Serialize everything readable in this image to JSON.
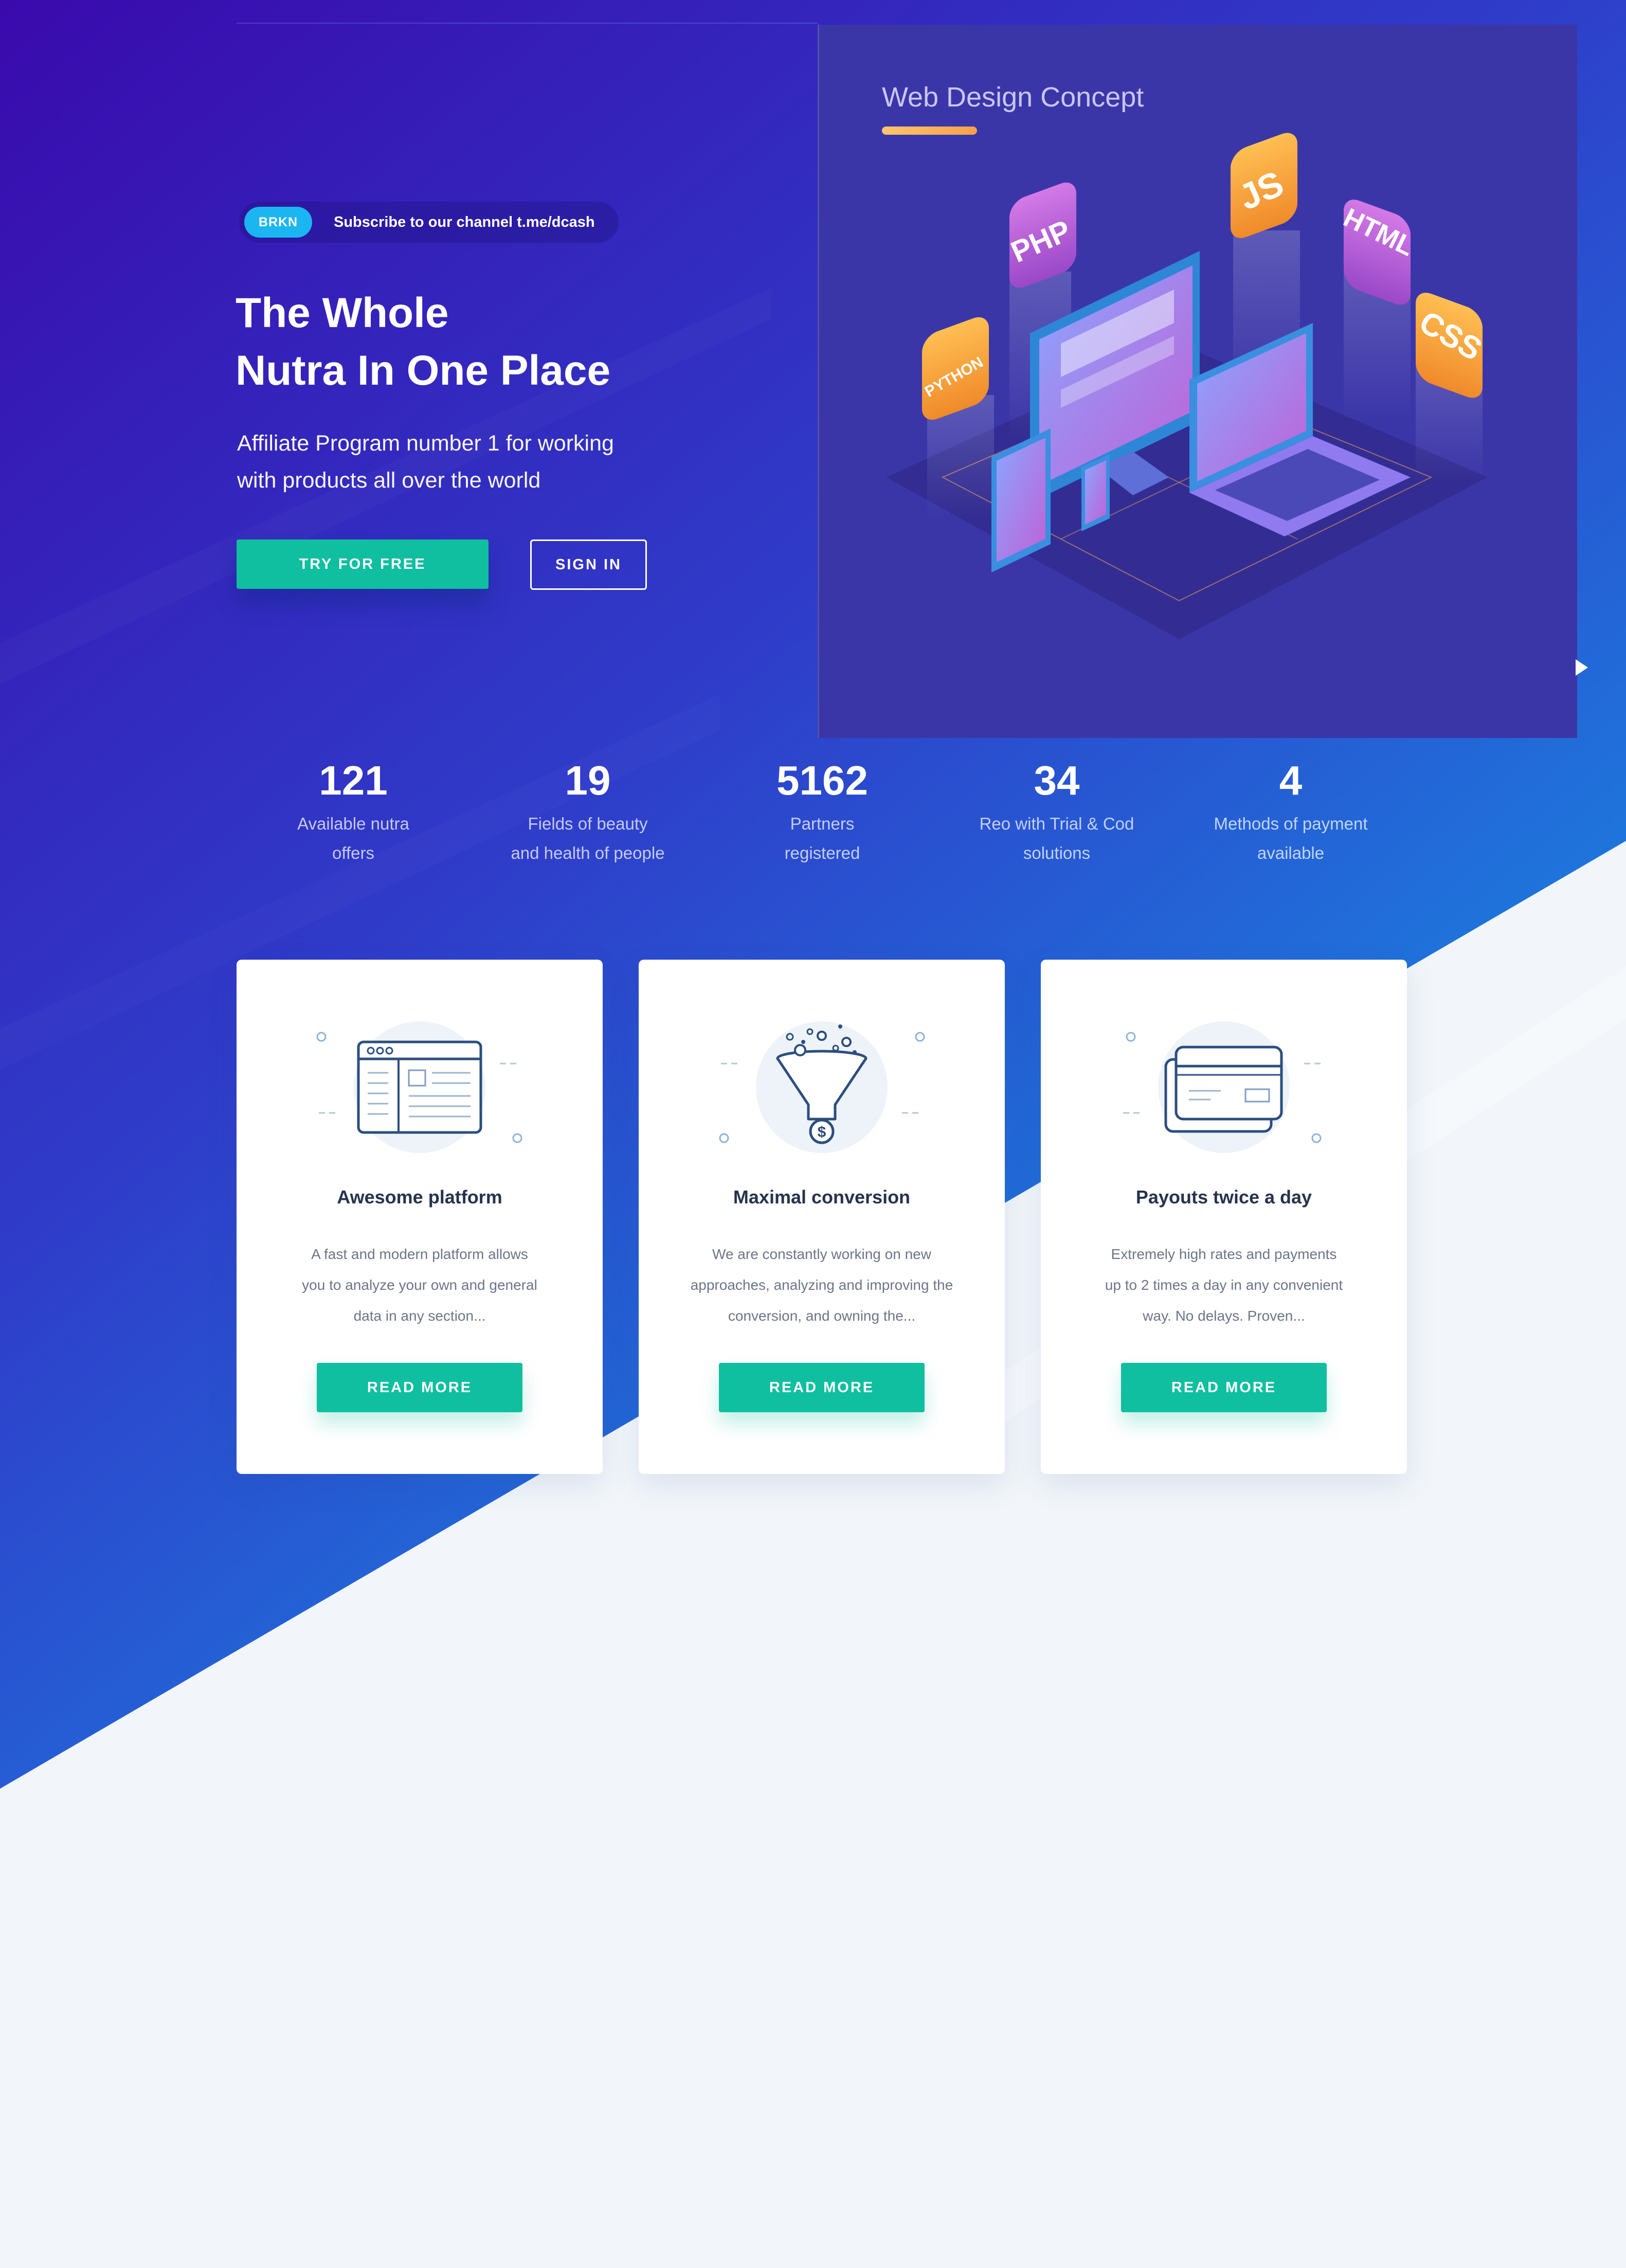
{
  "colors": {
    "accent": "#0fbf9f",
    "badge": "#1bb6f2",
    "hero_top": "#3a0aad",
    "hero_bottom": "#1593e6",
    "page_bg": "#f2f6fa",
    "card_title": "#26334d"
  },
  "hero": {
    "badge": "BRKN",
    "subscribe_text": "Subscribe to our channel t.me/dcash",
    "title_line1": "The Whole",
    "title_line2": "Nutra In One Place",
    "subtitle_line1": "Affiliate Program number 1 for working",
    "subtitle_line2": "with products all over the world",
    "try_button": "TRY FOR FREE",
    "signin_button": "SIGN IN"
  },
  "concept": {
    "title": "Web Design Concept",
    "tags": [
      "PYTHON",
      "PHP",
      "JS",
      "HTML",
      "CSS"
    ]
  },
  "stats": [
    {
      "value": "121",
      "line1": "Available nutra",
      "line2": "offers"
    },
    {
      "value": "19",
      "line1": "Fields of beauty",
      "line2": "and health of people"
    },
    {
      "value": "5162",
      "line1": "Partners",
      "line2": "registered"
    },
    {
      "value": "34",
      "line1": "Reo with Trial & Cod",
      "line2": "solutions"
    },
    {
      "value": "4",
      "line1": "Methods of payment",
      "line2": "available"
    }
  ],
  "cards": [
    {
      "icon": "browser-window-icon",
      "title": "Awesome platform",
      "line1": "A fast and modern platform allows",
      "line2": "you to analyze your own and general",
      "line3": "data in any section...",
      "button": "READ MORE"
    },
    {
      "icon": "funnel-icon",
      "title": "Maximal conversion",
      "line1": "We are constantly working on new",
      "line2": "approaches, analyzing and improving the",
      "line3": "conversion, and owning the...",
      "button": "READ MORE"
    },
    {
      "icon": "credit-card-icon",
      "title": "Payouts twice a day",
      "line1": "Extremely high rates and payments",
      "line2": "up to 2 times a day in any convenient",
      "line3": "way. No delays. Proven...",
      "button": "READ MORE"
    }
  ]
}
